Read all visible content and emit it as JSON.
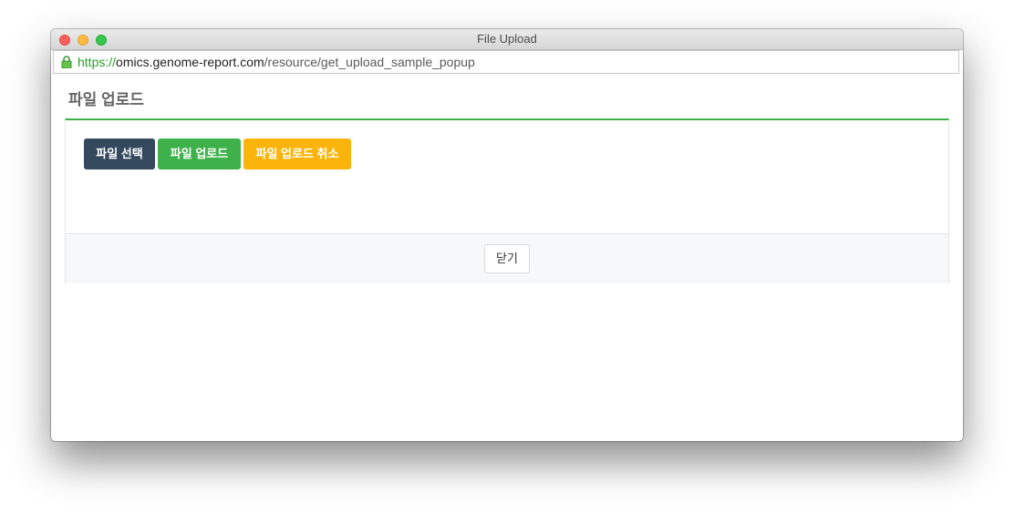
{
  "window": {
    "title": "File Upload"
  },
  "address_bar": {
    "scheme": "https://",
    "host": "omics.genome-report.com",
    "path": "/resource/get_upload_sample_popup",
    "secure_icon": "lock-icon"
  },
  "page": {
    "title": "파일 업로드",
    "buttons": {
      "select_label": "파일 선택",
      "upload_label": "파일 업로드",
      "cancel_label": "파일 업로드 취소"
    },
    "footer": {
      "close_label": "닫기"
    }
  },
  "colors": {
    "select_button": "#34495e",
    "upload_button": "#3fb14a",
    "cancel_button": "#fbb40b",
    "panel_accent": "#3fb14a"
  }
}
